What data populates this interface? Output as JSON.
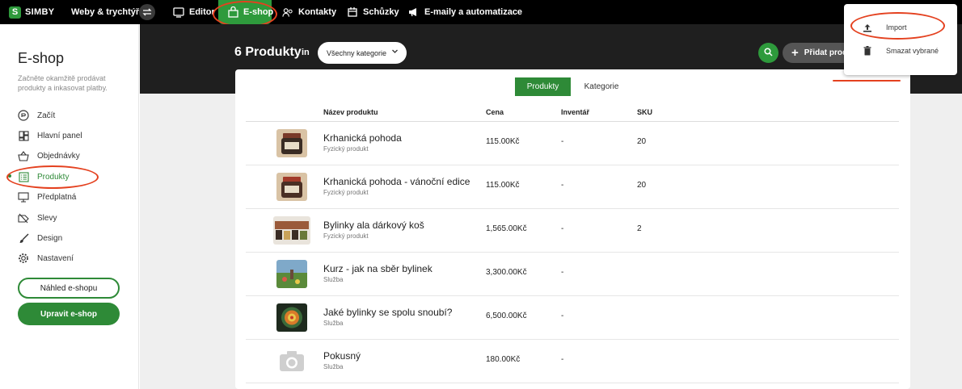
{
  "topbar": {
    "logo_letter": "S",
    "logo_text": "SIMBY",
    "site_name": "Weby & trychtýře",
    "nav": [
      {
        "label": "Editor",
        "icon": "editor-icon"
      },
      {
        "label": "E-shop",
        "icon": "shopping-bag-icon"
      },
      {
        "label": "Kontakty",
        "icon": "contacts-icon"
      },
      {
        "label": "Schůzky",
        "icon": "calendar-icon"
      },
      {
        "label": "E-maily a automatizace",
        "icon": "megaphone-icon"
      }
    ]
  },
  "sidebar": {
    "title": "E-shop",
    "subtitle": "Začněte okamžitě prodávat produkty a inkasovat platby.",
    "items": [
      {
        "label": "Začít",
        "icon": "start-icon"
      },
      {
        "label": "Hlavní panel",
        "icon": "dashboard-icon"
      },
      {
        "label": "Objednávky",
        "icon": "basket-icon"
      },
      {
        "label": "Produkty",
        "icon": "list-icon",
        "active": true
      },
      {
        "label": "Předplatná",
        "icon": "subscription-icon"
      },
      {
        "label": "Slevy",
        "icon": "discount-icon"
      },
      {
        "label": "Design",
        "icon": "brush-icon"
      },
      {
        "label": "Nastavení",
        "icon": "gear-icon"
      }
    ],
    "preview_button": "Náhled e-shopu",
    "edit_button": "Upravit e-shop"
  },
  "header": {
    "title": "6 Produkty",
    "in_label": "in",
    "category_select": "Všechny kategorie",
    "add_button": "Přidat produ"
  },
  "tabs": {
    "products": "Produkty",
    "categories": "Kategorie"
  },
  "table": {
    "columns": {
      "name": "Název produktu",
      "price": "Cena",
      "inventory": "Inventář",
      "sku": "SKU"
    },
    "rows": [
      {
        "name": "Krhanická pohoda",
        "type": "Fyzický produkt",
        "price": "115.00Kč",
        "inventory": "-",
        "sku": "20",
        "thumb": "jar"
      },
      {
        "name": "Krhanická pohoda - vánoční edice",
        "type": "Fyzický produkt",
        "price": "115.00Kč",
        "inventory": "-",
        "sku": "20",
        "thumb": "jar"
      },
      {
        "name": "Bylinky ala dárkový koš",
        "type": "Fyzický produkt",
        "price": "1,565.00Kč",
        "inventory": "-",
        "sku": "2",
        "thumb": "basket"
      },
      {
        "name": "Kurz - jak na sběr bylinek",
        "type": "Služba",
        "price": "3,300.00Kč",
        "inventory": "-",
        "sku": "",
        "thumb": "meadow"
      },
      {
        "name": "Jaké bylinky se spolu snoubí?",
        "type": "Služba",
        "price": "6,500.00Kč",
        "inventory": "-",
        "sku": "",
        "thumb": "mandala"
      },
      {
        "name": "Pokusný",
        "type": "Služba",
        "price": "180.00Kč",
        "inventory": "-",
        "sku": "",
        "thumb": "camera"
      }
    ]
  },
  "dropdown": {
    "import": "Import",
    "delete_selected": "Smazat vybrané"
  },
  "colors": {
    "accent": "#2e8a37",
    "annotation": "#e4411f"
  }
}
